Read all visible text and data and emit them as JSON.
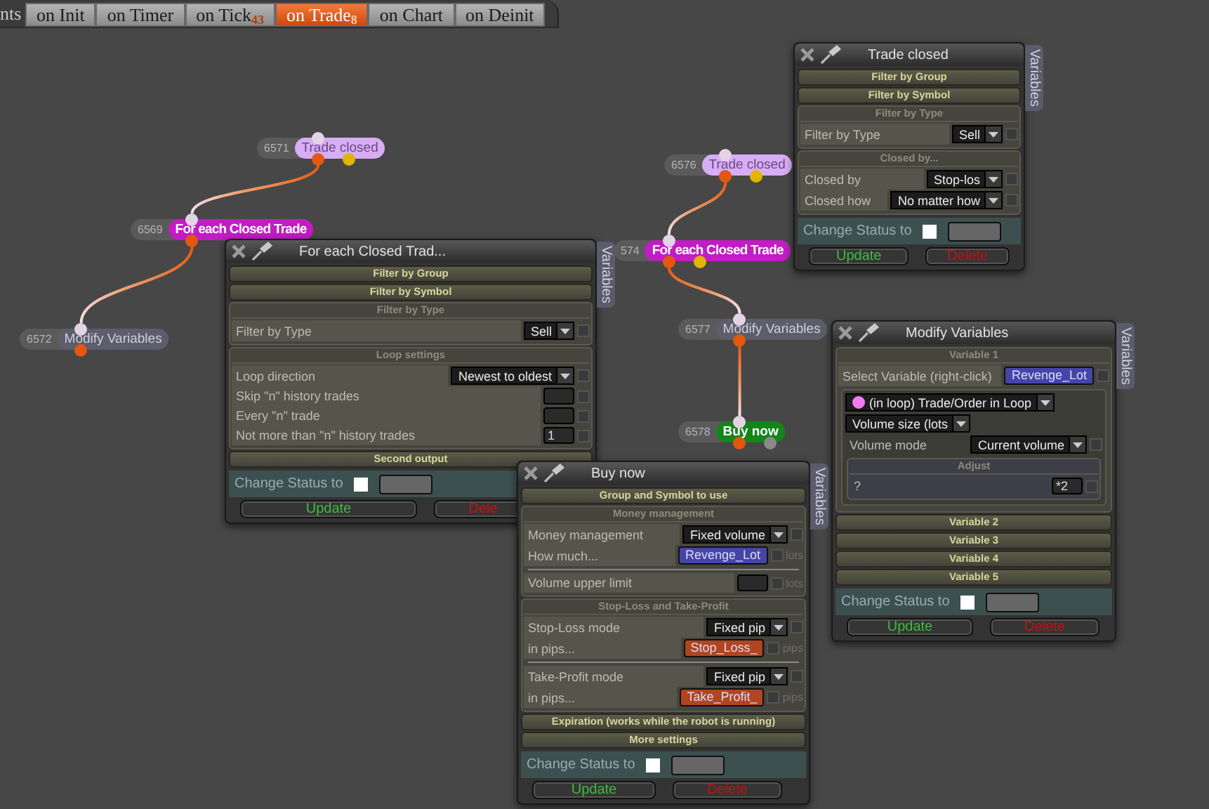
{
  "tab_bar": {
    "leading_text": "nts",
    "tabs": [
      {
        "label": "on Init",
        "selected": false
      },
      {
        "label": "on Timer",
        "selected": false
      },
      {
        "label": "on Tick",
        "badge": "43",
        "selected": false
      },
      {
        "label": "on Trade",
        "badge": "8",
        "selected": true
      },
      {
        "label": "on Chart",
        "selected": false
      },
      {
        "label": "on Deinit",
        "selected": false
      }
    ]
  },
  "flows": [
    [
      {
        "id": "6571",
        "label": "Trade closed",
        "kind": "event",
        "color": "#d7adf3",
        "outputs": [
          {
            "color": "#e4570f"
          },
          {
            "color": "#e0b400"
          }
        ]
      },
      {
        "id": "6569",
        "label": "For each Closed Trade",
        "kind": "loop",
        "color": "#c21cc4",
        "outputs": [
          {
            "color": "#e4570f"
          }
        ]
      },
      {
        "id": "6572",
        "label": "Modify Variables",
        "kind": "action",
        "color": "#5d5d6b",
        "outputs": [
          {
            "color": "#e4570f"
          }
        ]
      }
    ],
    [
      {
        "id": "6576",
        "label": "Trade closed",
        "kind": "event",
        "color": "#d7adf3",
        "outputs": [
          {
            "color": "#e4570f"
          },
          {
            "color": "#e0b400"
          }
        ]
      },
      {
        "id": "574",
        "label": "For each Closed Trade",
        "kind": "loop",
        "color": "#c21cc4",
        "outputs": [
          {
            "color": "#e4570f"
          },
          {
            "color": "#e0b400"
          }
        ]
      },
      {
        "id": "6577",
        "label": "Modify Variables",
        "kind": "action",
        "color": "#5d5d6b",
        "outputs": [
          {
            "color": "#e4570f"
          }
        ]
      },
      {
        "id": "6578",
        "label": "Buy now",
        "kind": "order",
        "color": "#13851a",
        "outputs": [
          {
            "color": "#e4570f"
          },
          {
            "color": "#8a8a8a"
          }
        ]
      }
    ]
  ],
  "panels": [
    {
      "title": "Trade closed",
      "side_tab": "Variables",
      "sections": [
        {
          "kind": "bar",
          "title": "Filter by Group"
        },
        {
          "kind": "bar",
          "title": "Filter by Symbol"
        },
        {
          "kind": "group",
          "title": "Filter by Type",
          "items": [
            {
              "kind": "row",
              "label": "Filter by Type",
              "controls": [
                {
                  "kind": "select",
                  "value": "Sell"
                },
                {
                  "kind": "check",
                  "checked": false
                }
              ]
            }
          ]
        },
        {
          "kind": "group",
          "title": "Closed by...",
          "items": [
            {
              "kind": "row",
              "label": "Closed by",
              "controls": [
                {
                  "kind": "select",
                  "value": "Stop-los"
                },
                {
                  "kind": "check",
                  "checked": false
                }
              ]
            },
            {
              "kind": "row",
              "label": "Closed how",
              "controls": [
                {
                  "kind": "select",
                  "value": "No matter how"
                },
                {
                  "kind": "check",
                  "checked": false
                }
              ]
            }
          ]
        }
      ],
      "status_label": "Change Status to",
      "status_checked": false,
      "buttons": [
        {
          "label": "Update",
          "kind": "update"
        },
        {
          "label": "Delete",
          "kind": "delete"
        }
      ]
    },
    {
      "title": "For each Closed Trad...",
      "side_tab": "Variables",
      "sections": [
        {
          "kind": "bar",
          "title": "Filter by Group"
        },
        {
          "kind": "bar",
          "title": "Filter by Symbol"
        },
        {
          "kind": "group",
          "title": "Filter by Type",
          "items": [
            {
              "kind": "row",
              "label": "Filter by Type",
              "controls": [
                {
                  "kind": "select",
                  "value": "Sell"
                },
                {
                  "kind": "check",
                  "checked": false
                }
              ]
            }
          ]
        },
        {
          "kind": "group",
          "title": "Loop settings",
          "items": [
            {
              "kind": "row",
              "label": "Loop direction",
              "controls": [
                {
                  "kind": "select",
                  "value": "Newest to oldest"
                },
                {
                  "kind": "check",
                  "checked": false
                }
              ]
            },
            {
              "kind": "row",
              "label": "Skip \"n\" history trades",
              "controls": [
                {
                  "kind": "input"
                },
                {
                  "kind": "check",
                  "checked": false
                }
              ]
            },
            {
              "kind": "row",
              "label": "Every \"n\" trade",
              "controls": [
                {
                  "kind": "input"
                },
                {
                  "kind": "check",
                  "checked": false
                }
              ]
            },
            {
              "kind": "row",
              "label": "Not more than \"n\" history trades",
              "controls": [
                {
                  "kind": "input",
                  "value": "1"
                },
                {
                  "kind": "check",
                  "checked": false
                }
              ]
            }
          ]
        },
        {
          "kind": "bar",
          "title": "Second output"
        }
      ],
      "status_label": "Change Status to",
      "status_checked": false,
      "buttons": [
        {
          "label": "Update",
          "kind": "update"
        },
        {
          "label": "Dele",
          "kind": "delete"
        }
      ]
    },
    {
      "title": "Modify Variables",
      "side_tab": "Variables",
      "sections": [
        {
          "kind": "group",
          "title": "Variable 1",
          "items": [
            {
              "kind": "row",
              "label": "Select Variable (right-click)",
              "controls": [
                {
                  "kind": "var",
                  "value": "Revenge_Lot",
                  "color": "#4545a8"
                },
                {
                  "kind": "check",
                  "checked": false
                }
              ]
            },
            {
              "kind": "box",
              "items": [
                {
                  "kind": "row",
                  "controls": [
                    {
                      "kind": "select",
                      "value": "(in loop) Trade/Order in Loop",
                      "color": "#f27af2"
                    }
                  ]
                },
                {
                  "kind": "row",
                  "controls": [
                    {
                      "kind": "select",
                      "value": "Volume size (lots"
                    }
                  ]
                },
                {
                  "kind": "row",
                  "label": "Volume mode",
                  "controls": [
                    {
                      "kind": "select",
                      "value": "Current volume"
                    },
                    {
                      "kind": "check",
                      "checked": false
                    }
                  ]
                },
                {
                  "kind": "group",
                  "title": "Adjust",
                  "items": [
                    {
                      "kind": "row",
                      "label": "?",
                      "controls": [
                        {
                          "kind": "input",
                          "value": "*2"
                        },
                        {
                          "kind": "check",
                          "checked": false
                        }
                      ]
                    }
                  ]
                }
              ]
            }
          ]
        },
        {
          "kind": "bar",
          "title": "Variable 2"
        },
        {
          "kind": "bar",
          "title": "Variable 3"
        },
        {
          "kind": "bar",
          "title": "Variable 4"
        },
        {
          "kind": "bar",
          "title": "Variable 5"
        }
      ],
      "status_label": "Change Status to",
      "status_checked": false,
      "buttons": [
        {
          "label": "Update",
          "kind": "update"
        },
        {
          "label": "Delete",
          "kind": "delete"
        }
      ]
    },
    {
      "title": "Buy now",
      "side_tab": "Variables",
      "sections": [
        {
          "kind": "bar",
          "title": "Group and Symbol to use"
        },
        {
          "kind": "group",
          "title": "Money management",
          "items": [
            {
              "kind": "row",
              "label": "Money management",
              "controls": [
                {
                  "kind": "select",
                  "value": "Fixed volume"
                },
                {
                  "kind": "check",
                  "checked": false
                }
              ]
            },
            {
              "kind": "row",
              "label": "How much...",
              "controls": [
                {
                  "kind": "var",
                  "value": "Revenge_Lot",
                  "color": "#4545a8"
                },
                {
                  "kind": "check",
                  "checked": false
                },
                {
                  "kind": "unit",
                  "value": "lots"
                }
              ]
            },
            {
              "kind": "rule"
            },
            {
              "kind": "row",
              "label": "Volume upper limit",
              "controls": [
                {
                  "kind": "input"
                },
                {
                  "kind": "check",
                  "checked": false
                },
                {
                  "kind": "unit",
                  "value": "lots"
                }
              ]
            }
          ]
        },
        {
          "kind": "group",
          "title": "Stop-Loss and Take-Profit",
          "items": [
            {
              "kind": "row",
              "label": "Stop-Loss mode",
              "controls": [
                {
                  "kind": "select",
                  "value": "Fixed pip"
                },
                {
                  "kind": "check",
                  "checked": false
                }
              ]
            },
            {
              "kind": "row",
              "label": "in pips...",
              "controls": [
                {
                  "kind": "var",
                  "value": "Stop_Loss_",
                  "color": "#b0451f"
                },
                {
                  "kind": "check",
                  "checked": false
                },
                {
                  "kind": "unit",
                  "value": "pips"
                }
              ]
            },
            {
              "kind": "rule"
            },
            {
              "kind": "row",
              "label": "Take-Profit mode",
              "controls": [
                {
                  "kind": "select",
                  "value": "Fixed pip"
                },
                {
                  "kind": "check",
                  "checked": false
                }
              ]
            },
            {
              "kind": "row",
              "label": "in pips...",
              "controls": [
                {
                  "kind": "var",
                  "value": "Take_Profit_",
                  "color": "#b0451f"
                },
                {
                  "kind": "check",
                  "checked": false
                },
                {
                  "kind": "unit",
                  "value": "pips"
                }
              ]
            }
          ]
        },
        {
          "kind": "bar",
          "title": "Expiration (works while the robot is running)"
        },
        {
          "kind": "bar",
          "title": "More settings"
        }
      ],
      "status_label": "Change Status to",
      "status_checked": false,
      "buttons": [
        {
          "label": "Update",
          "kind": "update"
        },
        {
          "label": "Delete",
          "kind": "delete"
        }
      ]
    }
  ]
}
